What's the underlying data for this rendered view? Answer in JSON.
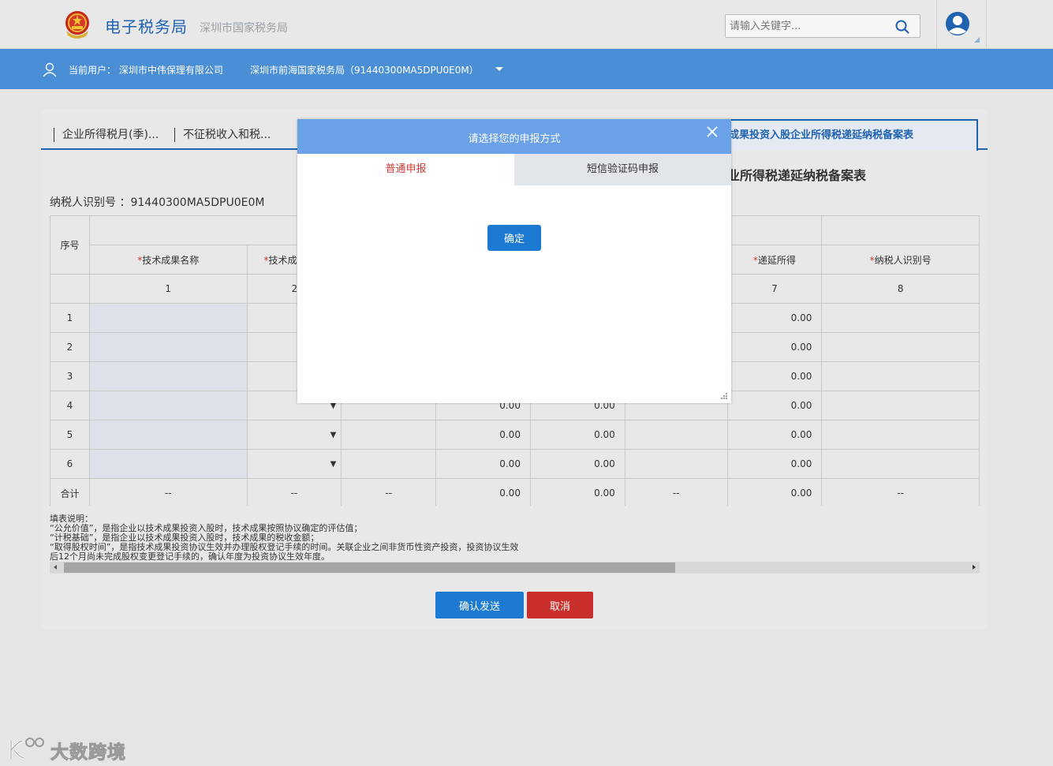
{
  "header": {
    "title": "电子税务局",
    "subtitle": "深圳市国家税务局",
    "search_placeholder": "请输入关键字..."
  },
  "userbar": {
    "current_user": "当前用户：  深圳市中伟保理有限公司",
    "tax_bureau": "深圳市前海国家税务局（91440300MA5DPU0E0M）"
  },
  "tabs": [
    {
      "label": "企业所得税月(季)..."
    },
    {
      "label": "不征税收入和税..."
    },
    {
      "label": "成果投资入股企业所得税递延纳税备案表"
    }
  ],
  "form": {
    "title": "业所得税递延纳税备案表",
    "taxpayer_id": "纳税人识别号 ：91440300MA5DPU0E0M"
  },
  "table": {
    "seq_header": "序号",
    "headers": {
      "col1": "技术成果名称",
      "col2": "技术成",
      "col7": "递延所得",
      "col8": "纳税人识别号",
      "required_mark": "*"
    },
    "col_numbers": [
      "1",
      "2",
      "7",
      "8"
    ],
    "rows": [
      {
        "seq": "1",
        "c7": "0.00"
      },
      {
        "seq": "2",
        "c7": "0.00"
      },
      {
        "seq": "3",
        "c7": "0.00"
      },
      {
        "seq": "4",
        "c4": "0.00",
        "c5": "0.00",
        "c7": "0.00"
      },
      {
        "seq": "5",
        "c4": "0.00",
        "c5": "0.00",
        "c7": "0.00"
      },
      {
        "seq": "6",
        "c4": "0.00",
        "c5": "0.00",
        "c7": "0.00"
      }
    ],
    "total": {
      "label": "合计",
      "c1": "--",
      "c2": "--",
      "c3": "--",
      "c4": "0.00",
      "c5": "0.00",
      "c6": "--",
      "c7": "0.00",
      "c8": "--"
    },
    "dropdown_glyph": "▼"
  },
  "notes": [
    "填表说明：",
    "“公允价值”，是指企业以技术成果投资入股时，技术成果按照协议确定的评估值；",
    "“计税基础”，是指企业以技术成果投资入股时，技术成果的税收金额；",
    "“取得股权时间”，是指技术成果投资协议生效并办理股权登记手续的时间。关联企业之间非货币性资产投资，投资协议生效",
    "后12个月尚未完成股权变更登记手续的，确认年度为投资协议生效年度。"
  ],
  "buttons": {
    "confirm": "确认发送",
    "cancel": "取消"
  },
  "modal": {
    "title": "请选择您的申报方式",
    "tab_normal": "普通申报",
    "tab_sms": "短信验证码申报",
    "ok": "确定"
  },
  "watermark": "大数跨境",
  "colors": {
    "brand_blue": "#1f63b0",
    "userbar_blue": "#4a8fd5",
    "modal_header": "#6ba1e6",
    "button_blue": "#1c7ad3",
    "button_red": "#c9302c",
    "required_red": "#d03a34"
  }
}
